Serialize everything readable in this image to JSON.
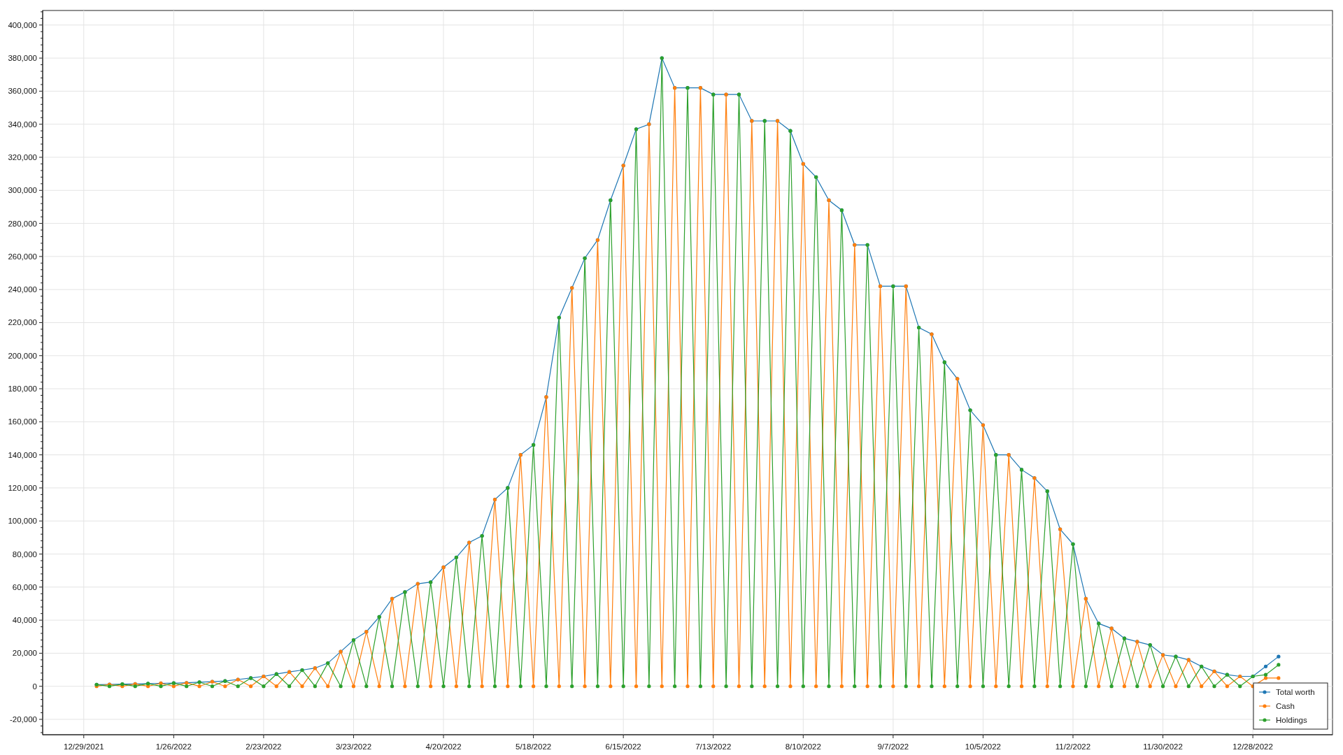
{
  "chart": {
    "chart_data": {
      "type": "line",
      "categories": [
        "12/29/2021",
        null,
        null,
        null,
        null,
        null,
        null,
        "1/26/2022",
        null,
        null,
        null,
        null,
        null,
        null,
        "2/23/2022",
        null,
        null,
        null,
        null,
        null,
        null,
        "3/23/2022",
        null,
        null,
        null,
        null,
        null,
        null,
        "4/20/2022",
        null,
        null,
        null,
        null,
        null,
        null,
        "5/18/2022",
        null,
        null,
        null,
        null,
        null,
        null,
        "6/15/2022",
        null,
        null,
        null,
        null,
        null,
        null,
        "7/13/2022",
        null,
        null,
        null,
        null,
        null,
        null,
        "8/10/2022",
        null,
        null,
        null,
        null,
        null,
        null,
        "9/7/2022",
        null,
        null,
        null,
        null,
        null,
        null,
        "10/5/2022",
        null,
        null,
        null,
        null,
        null,
        null,
        "11/2/2022",
        null,
        null,
        null,
        null,
        null,
        null,
        "11/30/2022",
        null,
        null,
        null,
        null,
        null,
        null,
        "12/28/2022",
        null,
        null
      ],
      "series": [
        {
          "name": "Total worth",
          "color": "#1f77b4",
          "values": [
            null,
            1000,
            1100,
            1300,
            1400,
            1600,
            1800,
            1900,
            2100,
            2500,
            2800,
            3200,
            4100,
            5000,
            6000,
            7400,
            8700,
            9800,
            11000,
            14000,
            21000,
            28000,
            33000,
            42000,
            53000,
            57000,
            62000,
            63000,
            72000,
            78000,
            87000,
            91000,
            113000,
            120000,
            140000,
            146000,
            175000,
            223000,
            241000,
            259000,
            270000,
            294000,
            315000,
            337000,
            340000,
            380000,
            362000,
            362000,
            362000,
            358000,
            358000,
            358000,
            342000,
            342000,
            342000,
            336000,
            316000,
            308000,
            294000,
            288000,
            267000,
            267000,
            242000,
            242000,
            242000,
            217000,
            213000,
            196000,
            186000,
            167000,
            158000,
            140000,
            140000,
            131000,
            126000,
            118000,
            95000,
            86000,
            53000,
            38000,
            35000,
            29000,
            27000,
            25000,
            19000,
            18000,
            16000,
            12000,
            9000,
            7000,
            6000,
            6000,
            12000,
            18000
          ]
        },
        {
          "name": "Cash",
          "color": "#ff7f0e",
          "values": [
            null,
            0,
            1100,
            0,
            1400,
            0,
            1800,
            0,
            2100,
            0,
            2800,
            0,
            4100,
            0,
            6000,
            0,
            8700,
            0,
            11000,
            0,
            21000,
            0,
            33000,
            0,
            53000,
            0,
            62000,
            0,
            72000,
            0,
            87000,
            0,
            113000,
            0,
            140000,
            0,
            175000,
            0,
            241000,
            0,
            270000,
            0,
            315000,
            0,
            340000,
            0,
            362000,
            0,
            362000,
            0,
            358000,
            0,
            342000,
            0,
            342000,
            0,
            316000,
            0,
            294000,
            0,
            267000,
            0,
            242000,
            0,
            242000,
            0,
            213000,
            0,
            186000,
            0,
            158000,
            0,
            140000,
            0,
            126000,
            0,
            95000,
            0,
            53000,
            0,
            35000,
            0,
            27000,
            0,
            19000,
            0,
            16000,
            0,
            9000,
            0,
            6000,
            0,
            5000,
            5000
          ]
        },
        {
          "name": "Holdings",
          "color": "#2ca02c",
          "values": [
            null,
            1000,
            0,
            1300,
            0,
            1600,
            0,
            1900,
            0,
            2500,
            0,
            3200,
            0,
            5000,
            0,
            7400,
            0,
            9800,
            0,
            14000,
            0,
            28000,
            0,
            42000,
            0,
            57000,
            0,
            63000,
            0,
            78000,
            0,
            91000,
            0,
            120000,
            0,
            146000,
            0,
            223000,
            0,
            259000,
            0,
            294000,
            0,
            337000,
            0,
            380000,
            0,
            362000,
            0,
            358000,
            0,
            358000,
            0,
            342000,
            0,
            336000,
            0,
            308000,
            0,
            288000,
            0,
            267000,
            0,
            242000,
            0,
            217000,
            0,
            196000,
            0,
            167000,
            0,
            140000,
            0,
            131000,
            0,
            118000,
            0,
            86000,
            0,
            38000,
            0,
            29000,
            0,
            25000,
            0,
            18000,
            0,
            12000,
            0,
            7000,
            0,
            6000,
            7000,
            13000
          ]
        }
      ],
      "grid": true,
      "legend": "bottom-right",
      "ylim": [
        -29300,
        408800
      ],
      "yticks": [
        {
          "value": -20000,
          "label": "-20,000"
        },
        {
          "value": 0,
          "label": "0"
        },
        {
          "value": 20000,
          "label": "20,000"
        },
        {
          "value": 40000,
          "label": "40,000"
        },
        {
          "value": 60000,
          "label": "60,000"
        },
        {
          "value": 80000,
          "label": "80,000"
        },
        {
          "value": 100000,
          "label": "100,000"
        },
        {
          "value": 120000,
          "label": "120,000"
        },
        {
          "value": 140000,
          "label": "140,000"
        },
        {
          "value": 160000,
          "label": "160,000"
        },
        {
          "value": 180000,
          "label": "180,000"
        },
        {
          "value": 200000,
          "label": "200,000"
        },
        {
          "value": 220000,
          "label": "220,000"
        },
        {
          "value": 240000,
          "label": "240,000"
        },
        {
          "value": 260000,
          "label": "260,000"
        },
        {
          "value": 280000,
          "label": "280,000"
        },
        {
          "value": 300000,
          "label": "300,000"
        },
        {
          "value": 320000,
          "label": "320,000"
        },
        {
          "value": 340000,
          "label": "340,000"
        },
        {
          "value": 360000,
          "label": "360,000"
        },
        {
          "value": 380000,
          "label": "380,000"
        },
        {
          "value": 400000,
          "label": "400,000"
        }
      ]
    }
  }
}
